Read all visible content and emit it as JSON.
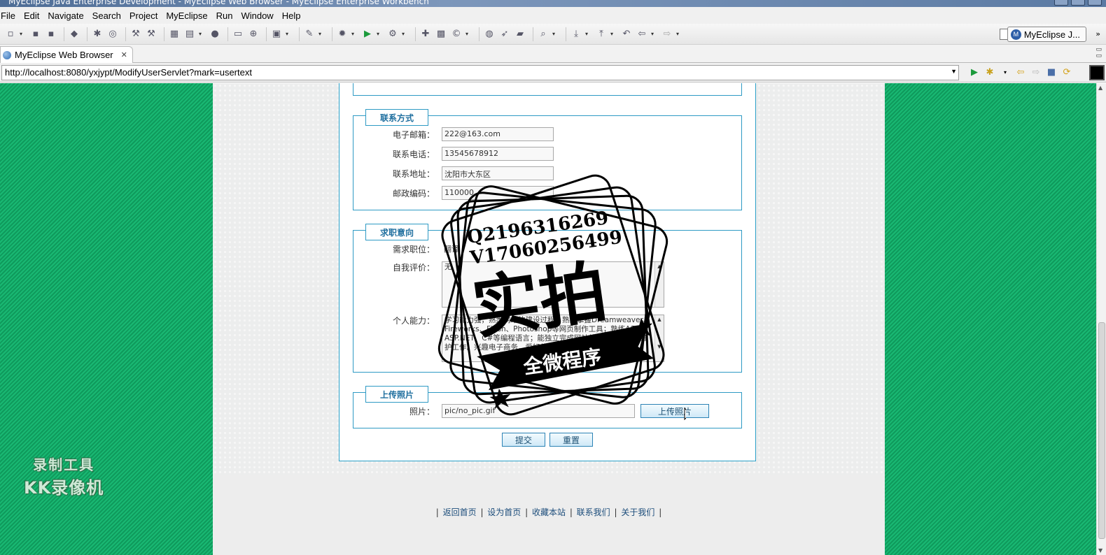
{
  "window": {
    "title": "MyEclipse Java Enterprise Development - MyEclipse Web Browser - MyEclipse Enterprise Workbench"
  },
  "menu": [
    "File",
    "Edit",
    "Navigate",
    "Search",
    "Project",
    "MyEclipse",
    "Run",
    "Window",
    "Help"
  ],
  "toolbar": {
    "perspective_label": "MyEclipse J..."
  },
  "editor_tab": {
    "label": "MyEclipse Web Browser"
  },
  "browser": {
    "url": "http://localhost:8080/yxjypt/ModifyUserServlet?mark=usertext"
  },
  "form": {
    "contact": {
      "legend": "联系方式",
      "email_label": "电子邮箱：",
      "email_value": "222@163.com",
      "phone_label": "联系电话：",
      "phone_value": "13545678912",
      "address_label": "联系地址：",
      "address_value": "沈阳市大东区",
      "zip_label": "邮政编码：",
      "zip_value": "110000"
    },
    "job": {
      "legend": "求职意向",
      "position_label": "需求职位：",
      "position_value": "翻译",
      "self_eval_label": "自我评价：",
      "self_eval_value": "无",
      "ability_label": "个人能力：",
      "ability_value": "学习能力强，熟悉网站的建设过程；熟练掌握Dreamweaver、Fireworks、Flash、Photoshop等网页制作工具；熟练ASP、ASP.NET、C#等编程语言；能独立完成网站的建设、推广和维护工作。兴趣电子商务，爱好体育运动：足球、台球、篮球"
    },
    "photo": {
      "legend": "上传照片",
      "photo_label": "照片：",
      "photo_value": "pic/no_pic.gif",
      "upload_button": "上传照片"
    },
    "submit_button": "提交",
    "reset_button": "重置"
  },
  "footer": {
    "links": [
      "返回首页",
      "设为首页",
      "收藏本站",
      "联系我们",
      "关于我们"
    ]
  },
  "overlays": {
    "recorder_line1": "录制工具",
    "recorder_line2": "KK录像机",
    "stamp_contact_1": "Q2196316269",
    "stamp_contact_2": "V17060256499",
    "stamp_main": "实拍",
    "stamp_banner": "全微程序"
  },
  "colors": {
    "side_green": "#13a866",
    "form_border": "#2e9ac4",
    "legend_text": "#1f6f9f"
  }
}
